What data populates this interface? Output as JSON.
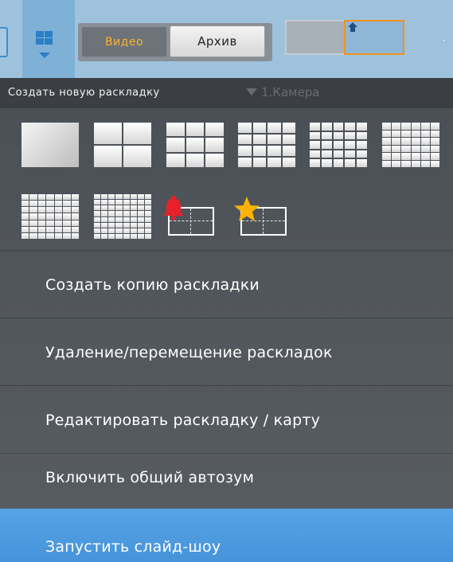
{
  "toolbar": {
    "video_tab": "Видео",
    "archive_tab": "Архив",
    "layout_button_icon": "grid-layout-icon",
    "colors": {
      "toolbar_bg": "#9fc2dc",
      "video_tab_text": "#ffb32e",
      "preview_border": "#f0921d"
    }
  },
  "menu": {
    "header": "Создать новую раскладку",
    "ghost_camera_label": "1.Камера",
    "layout_templates": [
      {
        "cells": "1x1"
      },
      {
        "cells": "2x2"
      },
      {
        "cells": "3x3"
      },
      {
        "cells": "4x4"
      },
      {
        "cells": "5x5"
      },
      {
        "cells": "6x6"
      },
      {
        "cells": "7x7"
      },
      {
        "cells": "8x8"
      },
      {
        "type": "alarm",
        "icon": "bell-icon",
        "color": "#e8202a"
      },
      {
        "type": "favorites",
        "icon": "star-icon",
        "color": "#ffb300"
      }
    ],
    "items": [
      {
        "label": "Создать копию раскладки"
      },
      {
        "label": "Удаление/перемещение раскладок"
      },
      {
        "label": "Редактировать раскладку / карту"
      },
      {
        "label": "Включить общий автозум"
      },
      {
        "label": "Запустить слайд-шоу",
        "highlighted": true
      }
    ],
    "highlight_color": "#4a98de"
  }
}
